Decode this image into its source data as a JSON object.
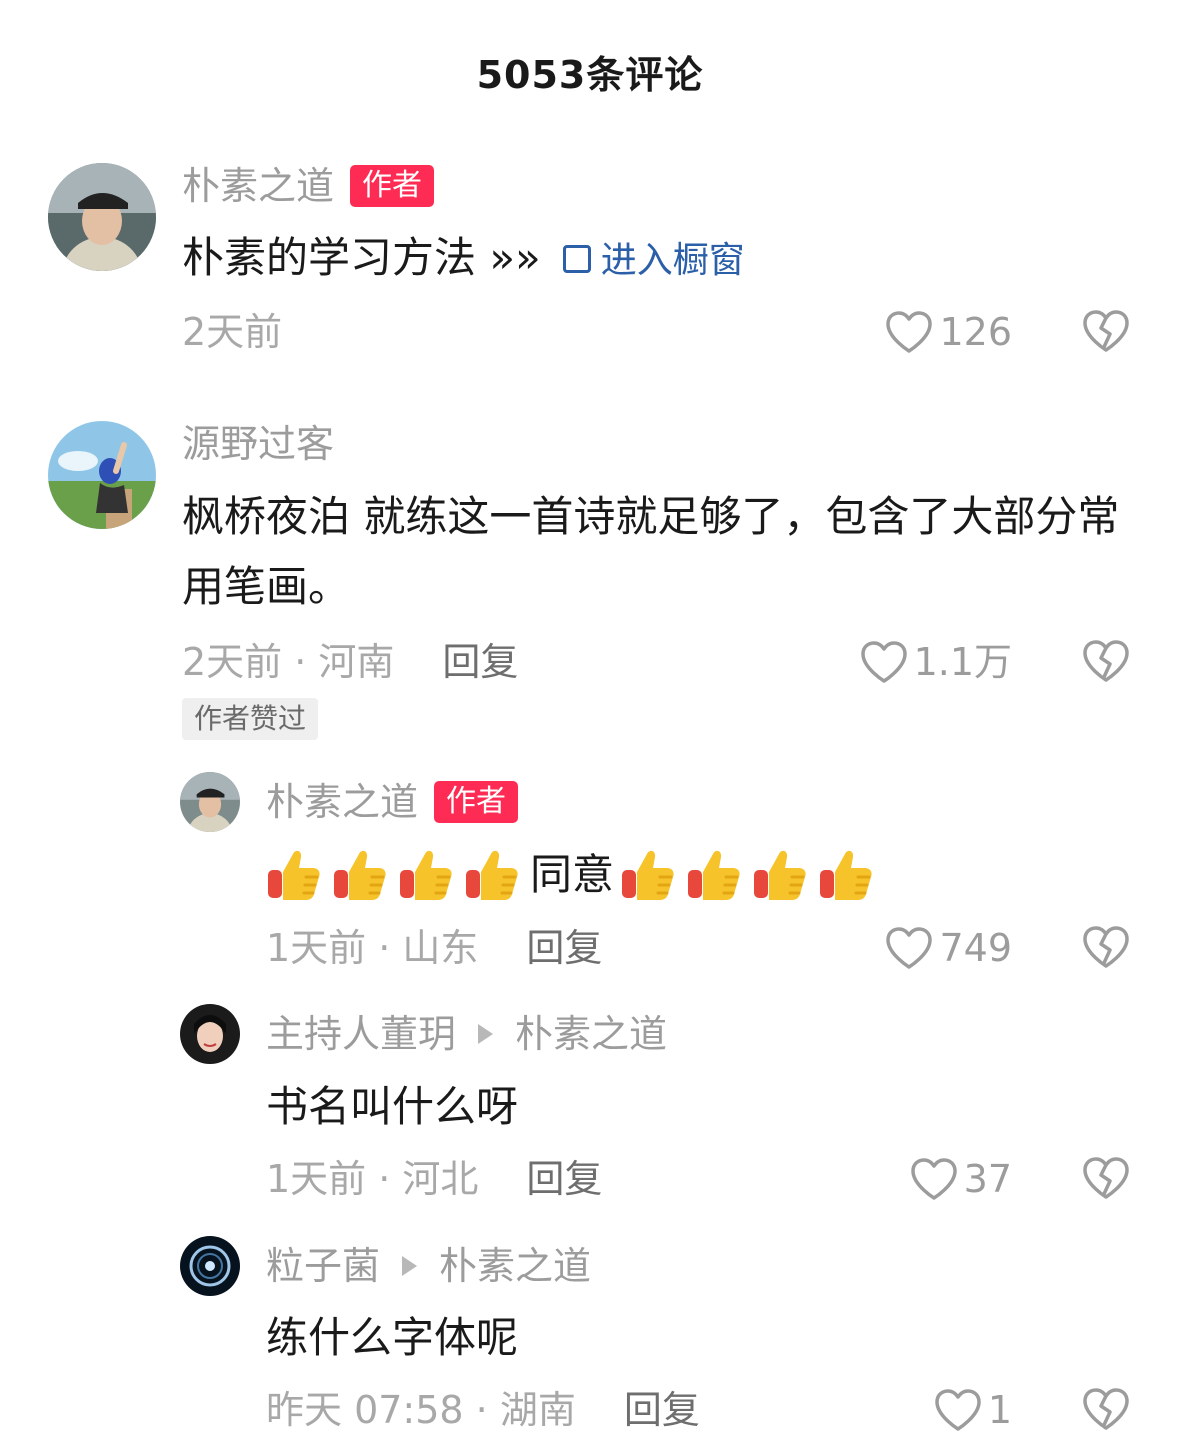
{
  "header": {
    "title": "5053条评论"
  },
  "comments": [
    {
      "username": "朴素之道",
      "badge": "作者",
      "text": "朴素的学习方法 »»",
      "link_label": "进入橱窗",
      "meta": "2天前",
      "likes": "126"
    },
    {
      "username": "源野过客",
      "text": "枫桥夜泊   就练这一首诗就足够了，包含了大部分常用笔画。",
      "meta": "2天前 · 河南",
      "reply_label": "回复",
      "likes": "1.1万",
      "liked_by_author": "作者赞过"
    }
  ],
  "replies": [
    {
      "username": "朴素之道",
      "badge": "作者",
      "text_mid": "同意",
      "thumbs_before": 4,
      "thumbs_after": 4,
      "meta": "1天前 · 山东",
      "reply_label": "回复",
      "likes": "749"
    },
    {
      "username": "主持人董玥",
      "reply_to": "朴素之道",
      "text": "书名叫什么呀",
      "meta": "1天前 · 河北",
      "reply_label": "回复",
      "likes": "37"
    },
    {
      "username": "粒子菌",
      "reply_to": "朴素之道",
      "text": "练什么字体呢",
      "meta": "昨天 07:58 · 湖南",
      "reply_label": "回复",
      "likes": "1"
    }
  ],
  "colors": {
    "badge": "#fe2c55",
    "link": "#2b5fa8",
    "meta": "#a8a8a8"
  },
  "icons": [
    "heart-icon",
    "dislike-heart-icon",
    "shop-icon",
    "thumbs-up-emoji",
    "reply-arrow-icon"
  ]
}
